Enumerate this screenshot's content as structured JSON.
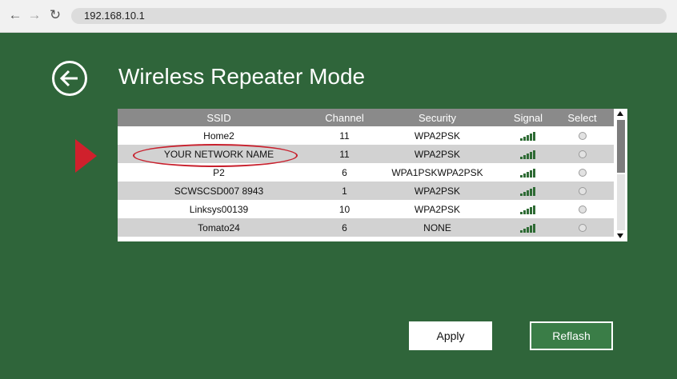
{
  "browser": {
    "url": "192.168.10.1",
    "back_icon": "←",
    "forward_icon": "→",
    "reload_icon": "↻"
  },
  "page": {
    "title": "Wireless Repeater Mode"
  },
  "table": {
    "headers": [
      "SSID",
      "Channel",
      "Security",
      "Signal",
      "Select"
    ],
    "rows": [
      {
        "ssid": "Home2",
        "channel": "11",
        "security": "WPA2PSK",
        "signal_bars": 5,
        "selected": false
      },
      {
        "ssid": "YOUR NETWORK NAME",
        "channel": "11",
        "security": "WPA2PSK",
        "signal_bars": 5,
        "selected": false
      },
      {
        "ssid": "P2",
        "channel": "6",
        "security": "WPA1PSKWPA2PSK",
        "signal_bars": 5,
        "selected": false
      },
      {
        "ssid": "SCWSCSD007 8943",
        "channel": "1",
        "security": "WPA2PSK",
        "signal_bars": 5,
        "selected": false
      },
      {
        "ssid": "Linksys00139",
        "channel": "10",
        "security": "WPA2PSK",
        "signal_bars": 5,
        "selected": false
      },
      {
        "ssid": "Tomato24",
        "channel": "6",
        "security": "NONE",
        "signal_bars": 5,
        "selected": false
      }
    ]
  },
  "buttons": {
    "apply": "Apply",
    "refresh": "Reflash"
  },
  "colors": {
    "page_background": "#2f653a",
    "signal_bar": "#2e6b34",
    "highlight": "#c8202d",
    "pointer_arrow": "#d0202c"
  }
}
